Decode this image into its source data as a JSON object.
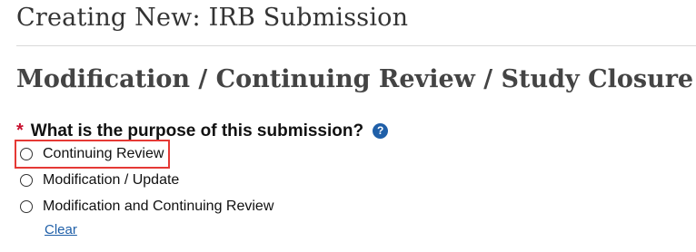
{
  "page": {
    "title": "Creating New: IRB Submission",
    "section_title": "Modification / Continuing Review / Study Closure"
  },
  "question": {
    "required_marker": "*",
    "label": "What is the purpose of this submission?",
    "help_icon": "question-circle-icon",
    "help_glyph": "?",
    "options": [
      {
        "label": "Continuing Review",
        "selected": false,
        "highlighted": true
      },
      {
        "label": "Modification / Update",
        "selected": false,
        "highlighted": false
      },
      {
        "label": "Modification and Continuing Review",
        "selected": false,
        "highlighted": false
      }
    ],
    "clear_label": "Clear"
  },
  "colors": {
    "required": "#c8102e",
    "help_icon": "#1f5fa8",
    "link": "#1f5fa8",
    "highlight": "#e53935"
  }
}
